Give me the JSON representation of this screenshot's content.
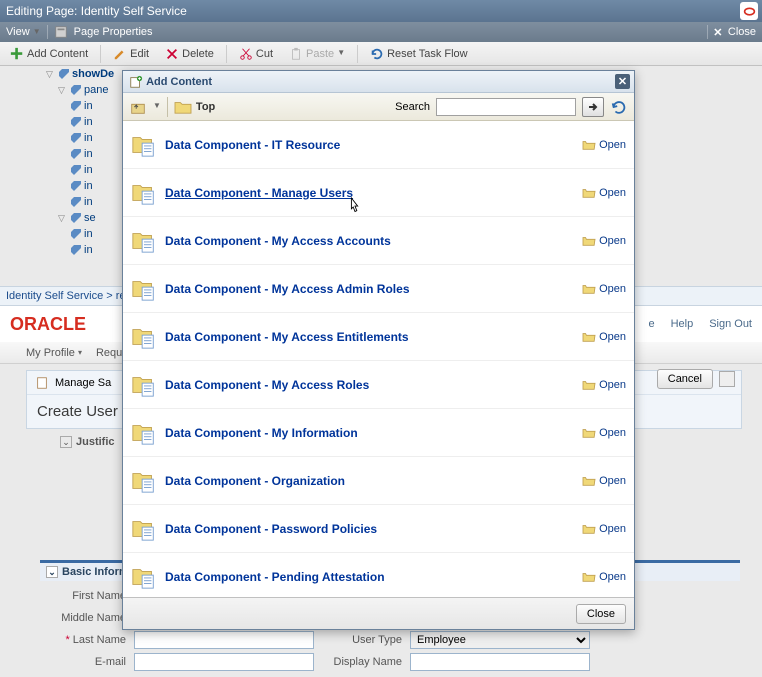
{
  "titlebar": {
    "prefix": "Editing Page:",
    "title": "Identity Self Service"
  },
  "bar2": {
    "view": "View",
    "page_properties": "Page Properties",
    "close": "Close"
  },
  "bar3": {
    "add_content": "Add Content",
    "edit": "Edit",
    "delete": "Delete",
    "cut": "Cut",
    "paste": "Paste",
    "reset": "Reset Task Flow"
  },
  "tree": {
    "root": "showDe",
    "pane": "pane",
    "in": "in",
    "se": "se"
  },
  "breadcrumb": {
    "part1": "Identity Self Service",
    "sep": ">",
    "part2": "re"
  },
  "oracle_links": {
    "e": "e",
    "help": "Help",
    "sign_out": "Sign Out"
  },
  "subnav": {
    "my_profile": "My Profile",
    "req": "Requ"
  },
  "panel": {
    "manage": "Manage Sa",
    "create_user": "Create User",
    "justification": "Justific",
    "cancel": "Cancel"
  },
  "basic_info": {
    "header": "Basic Inforn",
    "first_name": "First Name",
    "middle_name": "Middle Name",
    "last_name": "Last Name",
    "email": "E-mail",
    "user_type": "User Type",
    "display_name": "Display Name",
    "user_type_val": "Employee"
  },
  "modal": {
    "title": "Add Content",
    "top": "Top",
    "search": "Search",
    "open": "Open",
    "close": "Close",
    "components": [
      "Data Component - IT Resource",
      "Data Component - Manage Users",
      "Data Component - My Access Accounts",
      "Data Component - My Access Admin Roles",
      "Data Component - My Access Entitlements",
      "Data Component - My Access Roles",
      "Data Component - My Information",
      "Data Component - Organization",
      "Data Component - Password Policies",
      "Data Component - Pending Attestation"
    ]
  }
}
